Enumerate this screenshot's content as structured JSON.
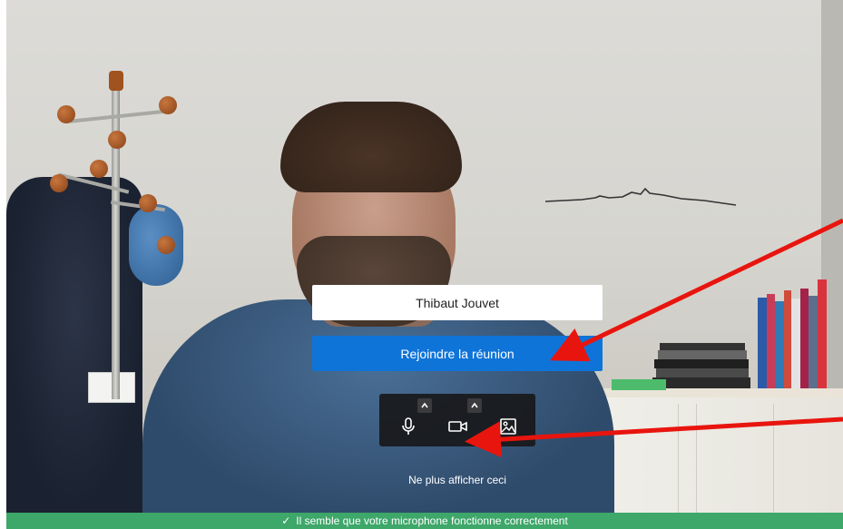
{
  "prejoin": {
    "name_value": "Thibaut Jouvet",
    "join_button_label": "Rejoindre la réunion",
    "hide_link_label": "Ne plus afficher ceci"
  },
  "toolbar": {
    "microphone_icon": "microphone-icon",
    "camera_icon": "video-camera-icon",
    "background_icon": "image-background-icon",
    "caret_icon": "chevron-up-icon"
  },
  "status": {
    "check_icon": "✓",
    "message": "Il semble que votre microphone fonctionne correctement",
    "color": "#3ea76a"
  },
  "colors": {
    "accent": "#0f74d8",
    "annotation_arrow": "#e8150e"
  }
}
